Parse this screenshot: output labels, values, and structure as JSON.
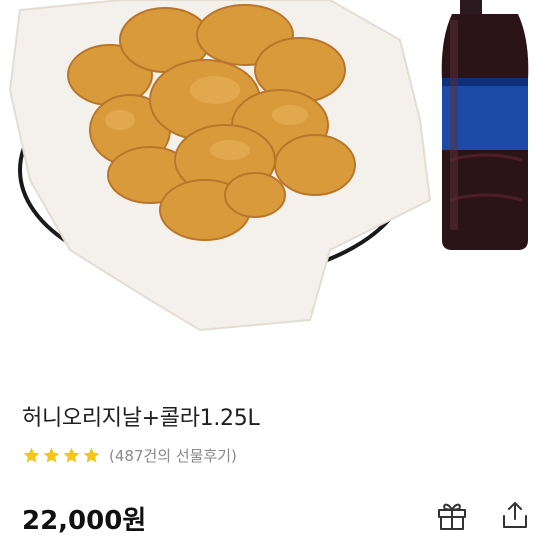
{
  "product": {
    "name": "허니오리지날+콜라1.25L",
    "rating": 4,
    "rating_max": 4,
    "review_count_text": "(487건의 선물후기)",
    "price": "22,000원"
  },
  "image": {
    "description_icon": "fried-chicken-and-cola-photo"
  },
  "actions": {
    "gift_icon": "gift-icon",
    "share_icon": "share-icon"
  },
  "colors": {
    "star": "#f5c518",
    "review_text": "#8a8a8a",
    "price_text": "#111111"
  }
}
